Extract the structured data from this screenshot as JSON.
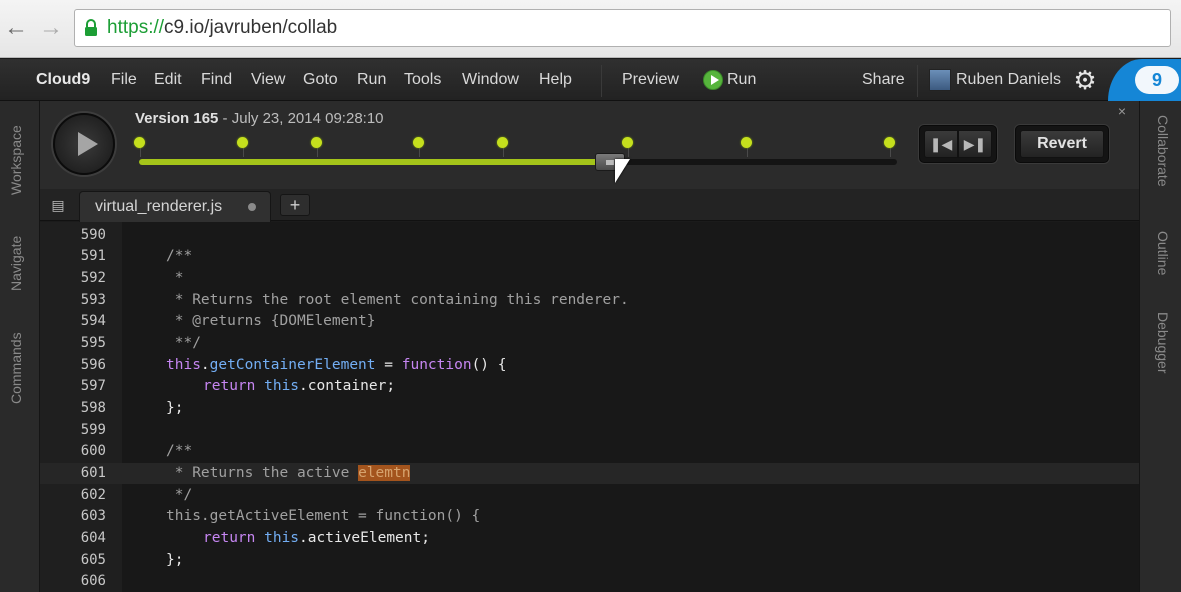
{
  "browser": {
    "url_protocol": "https://",
    "url_rest": "c9.io/javruben/collab",
    "back_icon": "arrow-left-icon",
    "forward_icon": "arrow-right-icon"
  },
  "menubar": {
    "brand": "Cloud9",
    "items": [
      "File",
      "Edit",
      "Find",
      "View",
      "Goto",
      "Run",
      "Tools",
      "Window",
      "Help"
    ],
    "preview": "Preview",
    "run": "Run",
    "share": "Share",
    "user": "Ruben Daniels"
  },
  "left_panels": [
    "Workspace",
    "Navigate",
    "Commands"
  ],
  "right_panels": [
    "Collaborate",
    "Outline",
    "Debugger"
  ],
  "timeline": {
    "version_label": "Version 165",
    "version_date": " - July 23, 2014 09:28:10",
    "revert_label": "Revert",
    "progress": 0.62,
    "colors": {
      "accent": "#a4c41a",
      "dot": "#c5e01d"
    }
  },
  "tabs": {
    "file": "virtual_renderer.js",
    "add": "+"
  },
  "code": {
    "line_numbers": [
      "590",
      "591",
      "592",
      "593",
      "594",
      "595",
      "596",
      "597",
      "598",
      "599",
      "600",
      "601",
      "602",
      "603",
      "604",
      "605",
      "606"
    ],
    "lines": {
      "l591": "/**",
      "l592": " *",
      "l593": " * Returns the root element containing this renderer.",
      "l594": " * @returns {DOMElement}",
      "l595": " **/",
      "l596_this": "this",
      "l596_dot": ".",
      "l596_name": "getContainerElement",
      "l596_eq": " = ",
      "l596_fn": "function",
      "l596_rest": "() {",
      "l597_ret": "return ",
      "l597_this": "this",
      "l597_rest": ".container;",
      "l598": "};",
      "l600": "/**",
      "l601_a": " * Returns the active ",
      "l601_b": "elemtn",
      "l602": " */",
      "l603": "this.getActiveElement = function() {",
      "l604_ret": "return ",
      "l604_this": "this",
      "l604_rest": ".activeElement;",
      "l605": "};"
    }
  }
}
